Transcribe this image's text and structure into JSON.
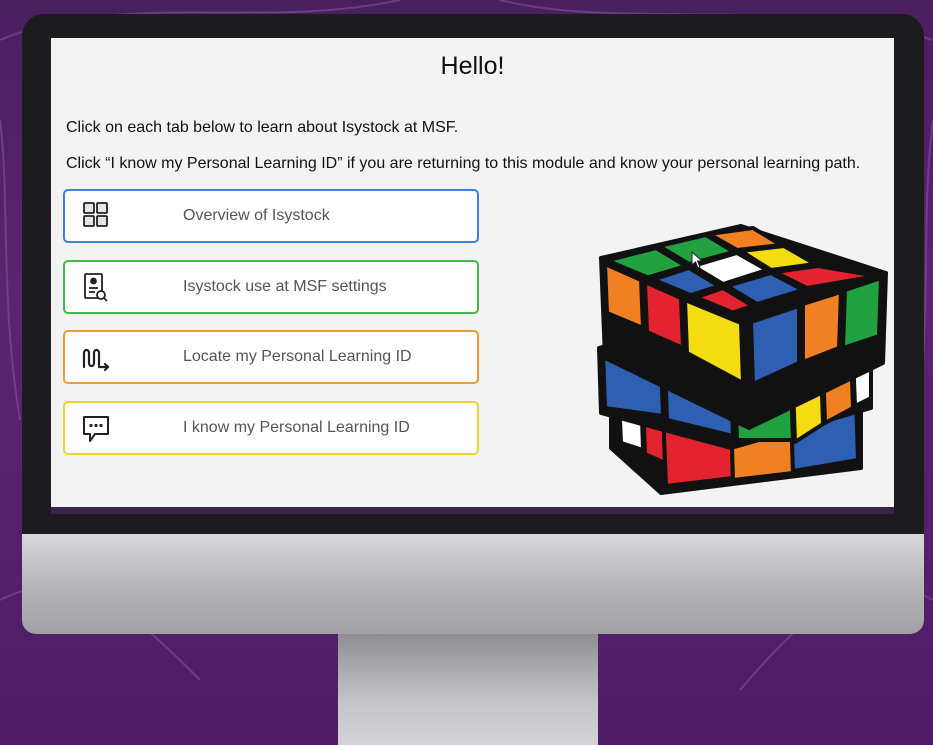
{
  "screen": {
    "title": "Hello!",
    "intro": "Click on each tab below to learn about Isystock at MSF.",
    "instruction": "Click “I know my Personal Learning ID” if you are returning to this module and know your personal learning path."
  },
  "tabs": [
    {
      "label": "Overview of Isystock",
      "icon": "grid-icon",
      "color": "#3f7fd6"
    },
    {
      "label": "Isystock use at MSF settings",
      "icon": "document-search-icon",
      "color": "#45b84a"
    },
    {
      "label": "Locate my Personal Learning ID",
      "icon": "path-arrow-icon",
      "color": "#ee9a3a"
    },
    {
      "label": "I know my Personal Learning ID",
      "icon": "chat-bubble-icon",
      "color": "#ecd531"
    }
  ],
  "illustration": {
    "name": "rubiks-cube"
  },
  "colors": {
    "background": "#4e1c66",
    "screen": "#f3f3f3"
  }
}
